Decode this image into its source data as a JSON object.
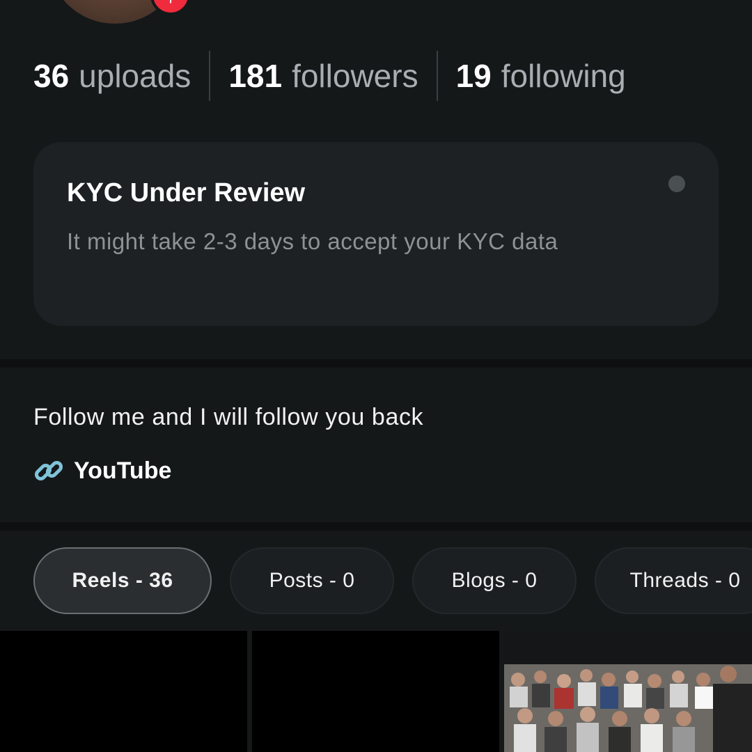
{
  "profile": {
    "add_badge_symbol": "+"
  },
  "stats": [
    {
      "count": "36",
      "label": "uploads"
    },
    {
      "count": "181",
      "label": "followers"
    },
    {
      "count": "19",
      "label": "following"
    }
  ],
  "kyc": {
    "title": "KYC Under Review",
    "description": "It might take 2-3 days to accept your KYC data"
  },
  "bio": {
    "text": "Follow me and I will follow you back",
    "link_icon": "link-icon",
    "link_label": "YouTube"
  },
  "tabs": [
    {
      "label": "Reels - 36",
      "active": true
    },
    {
      "label": "Posts - 0",
      "active": false
    },
    {
      "label": "Blogs - 0",
      "active": false
    },
    {
      "label": "Threads - 0",
      "active": false
    }
  ],
  "colors": {
    "background": "#151819",
    "card": "#1d2123",
    "badge": "#ef2b3d",
    "link_icon": "#7fc3d8"
  }
}
